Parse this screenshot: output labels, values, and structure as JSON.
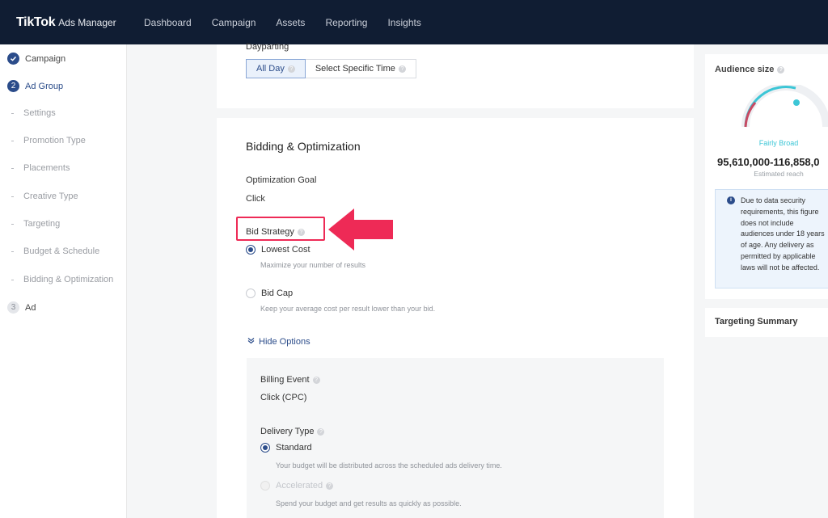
{
  "topbar": {
    "brand": "TikTok",
    "brand_sub": "Ads Manager",
    "nav": [
      "Dashboard",
      "Campaign",
      "Assets",
      "Reporting",
      "Insights"
    ]
  },
  "sidebar": {
    "campaign": {
      "label": "Campaign",
      "icon": "check-icon"
    },
    "ad_group": {
      "number": "2",
      "label": "Ad Group"
    },
    "substeps": [
      "Settings",
      "Promotion Type",
      "Placements",
      "Creative Type",
      "Targeting",
      "Budget & Schedule",
      "Bidding & Optimization"
    ],
    "ad": {
      "number": "3",
      "label": "Ad"
    }
  },
  "dayparting": {
    "label": "Dayparting",
    "options": [
      "All Day",
      "Select Specific Time"
    ],
    "selected": "All Day"
  },
  "bidding": {
    "title": "Bidding & Optimization",
    "optimization_goal_label": "Optimization Goal",
    "optimization_goal_value": "Click",
    "bid_strategy_label": "Bid Strategy",
    "lowest_cost": {
      "label": "Lowest Cost",
      "help": "Maximize your number of results"
    },
    "bid_cap": {
      "label": "Bid Cap",
      "help": "Keep your average cost per result lower than your bid."
    },
    "hide_options": "Hide Options",
    "billing_event_label": "Billing Event",
    "billing_event_value": "Click (CPC)",
    "delivery_type_label": "Delivery Type",
    "standard": {
      "label": "Standard",
      "help": "Your budget will be distributed across the scheduled ads delivery time."
    },
    "accelerated": {
      "label": "Accelerated",
      "help": "Spend your budget and get results as quickly as possible."
    }
  },
  "audience": {
    "title": "Audience size",
    "level": "Fairly Broad",
    "range": "95,610,000-116,858,0",
    "caption": "Estimated reach",
    "notice": "Due to data security requirements, this figure does not include audiences under 18 years of age. Any delivery as permitted by applicable laws will not be affected."
  },
  "targeting_summary": {
    "title": "Targeting Summary"
  },
  "colors": {
    "nav_bg": "#101d33",
    "accent": "#2b4c8a",
    "highlight": "#ee2a56",
    "gauge_teal": "#3cc6d6"
  }
}
